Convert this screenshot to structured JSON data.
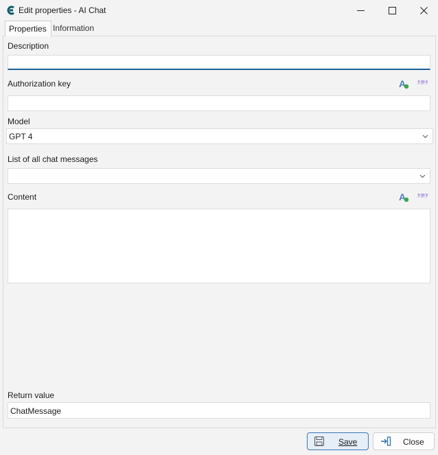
{
  "window": {
    "title": "Edit properties - AI Chat"
  },
  "tabs": [
    {
      "label": "Properties",
      "active": true
    },
    {
      "label": "Information",
      "active": false
    }
  ],
  "fields": {
    "description": {
      "label": "Description",
      "value": ""
    },
    "authorization_key": {
      "label": "Authorization key",
      "value": ""
    },
    "model": {
      "label": "Model",
      "value": "GPT 4"
    },
    "chat_messages": {
      "label": "List of all chat messages",
      "value": ""
    },
    "content": {
      "label": "Content",
      "value": ""
    },
    "return_value": {
      "label": "Return value",
      "value": "ChatMessage"
    }
  },
  "buttons": {
    "save": "Save",
    "close": "Close"
  },
  "colors": {
    "accent": "#1d5e96",
    "aux_icon_blue": "#4a7fbf",
    "aux_icon_green": "#3fa34d",
    "quote_icon": "#b9a7e0"
  }
}
